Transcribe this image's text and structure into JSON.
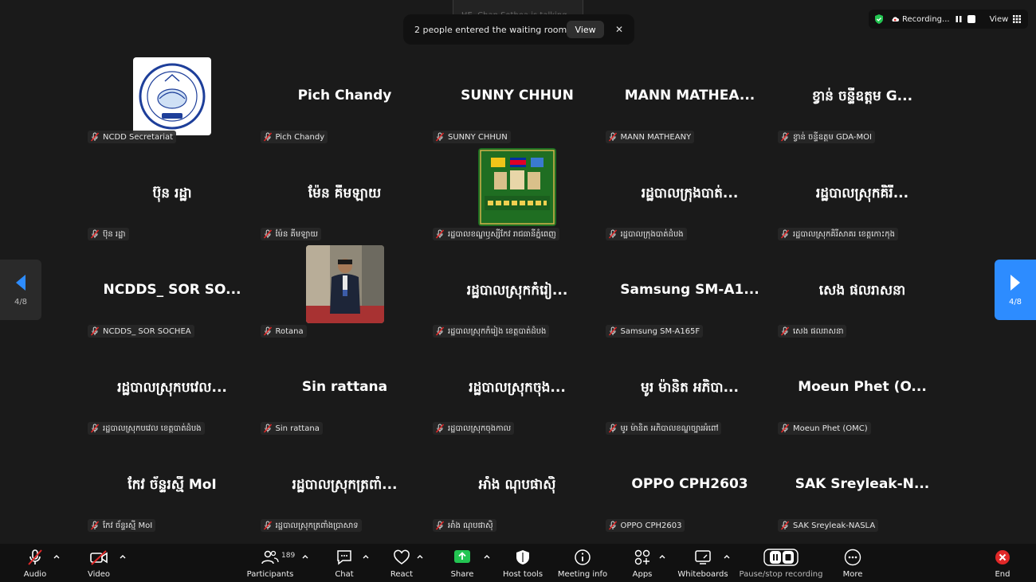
{
  "notifications": {
    "talking": "HE. Chan Sothea is talking...",
    "waiting_room": "2 people entered the waiting room",
    "view_button": "View",
    "close": "✕"
  },
  "recording_bar": {
    "status": "Recording...",
    "view": "View"
  },
  "pagination": {
    "left": "4/8",
    "right": "4/8"
  },
  "participants": [
    {
      "name": "",
      "label": "NCDD Secretariat",
      "avatar": "ncdd-logo"
    },
    {
      "name": "Pich Chandy",
      "label": "Pich Chandy"
    },
    {
      "name": "SUNNY CHHUN",
      "label": "SUNNY CHHUN"
    },
    {
      "name": "MANN  MATHEA...",
      "label": "MANN MATHEANY"
    },
    {
      "name": "ខ្វាន់ ចន្ទីឧត្តម G...",
      "label": "ខ្វាន់ ចន្ទីឧត្តម GDA-MOI"
    },
    {
      "name": "ប៊ុន រដ្ឋា",
      "label": "ប៊ុន រដ្ឋា"
    },
    {
      "name": "ម៉ែន គីមឡាយ",
      "label": "ម៉ែន គីមឡាយ"
    },
    {
      "name": "",
      "label": "រដ្ឋបាលខណ្ឌឫស្សីកែវ រាជធានីភ្នំពេញ",
      "avatar": "russey-keo-logo"
    },
    {
      "name": "រដ្ឋបាលក្រុងបាត់...",
      "label": "រដ្ឋបាលក្រុងបាត់ដំបង"
    },
    {
      "name": "រដ្ឋបាលស្រុកគិរី...",
      "label": "រដ្ឋបាលស្រុកគិរីសាគរ ខេត្តកោះកុង"
    },
    {
      "name": "NCDDS_ SOR SO...",
      "label": "NCDDS_ SOR SOCHEA"
    },
    {
      "name": "",
      "label": "Rotana",
      "avatar": "rotana-photo"
    },
    {
      "name": "រដ្ឋបាលស្រុកកំរៀ...",
      "label": "រដ្ឋបាលស្រុកកំរៀង ខេត្តបាត់ដំបង"
    },
    {
      "name": "Samsung  SM-A1...",
      "label": "Samsung SM-A165F"
    },
    {
      "name": "សេង ផលរាសនា",
      "label": "សេង ផលរាសនា"
    },
    {
      "name": "រដ្ឋបាលស្រុកបវេល...",
      "label": "រដ្ឋបាលស្រុកបវេល ខេត្តបាត់ដំបង"
    },
    {
      "name": "Sin rattana",
      "label": "Sin rattana"
    },
    {
      "name": "រដ្ឋបាលស្រុកចុង...",
      "label": "រដ្ឋបាលស្រុកចុងកាល"
    },
    {
      "name": "មូរ ម៉ានិត អភិបា...",
      "label": "មូរ ម៉ានិត អភិបាលខណ្ឌច្បារអំពៅ"
    },
    {
      "name": "Moeun  Phet  (O...",
      "label": "Moeun Phet (OMC)"
    },
    {
      "name": "កែវ ច័ន្ទរស្មី MoI",
      "label": "កែវ ច័ន្ទរស្មី MoI"
    },
    {
      "name": "រដ្ឋបាលស្រុកត្រពាំ...",
      "label": "រដ្ឋបាលស្រុកត្រពាំងប្រាសាទ"
    },
    {
      "name": "អាំង ណុបផាសុិ",
      "label": "អាំង ណុបផាសុិ"
    },
    {
      "name": "OPPO CPH2603",
      "label": "OPPO CPH2603"
    },
    {
      "name": "SAK  Sreyleak-N...",
      "label": "SAK Sreyleak-NASLA"
    }
  ],
  "toolbar": {
    "audio": "Audio",
    "video": "Video",
    "participants": "Participants",
    "participants_count": "189",
    "chat": "Chat",
    "react": "React",
    "share": "Share",
    "host_tools": "Host tools",
    "meeting_info": "Meeting info",
    "apps": "Apps",
    "whiteboards": "Whiteboards",
    "pause_stop_recording": "Pause/stop recording",
    "more": "More",
    "end": "End"
  },
  "colors": {
    "background": "#1a1a1a",
    "accent_blue": "#2d8cff",
    "muted_red": "#e02828",
    "share_green": "#23c552",
    "end_red": "#e02828"
  }
}
